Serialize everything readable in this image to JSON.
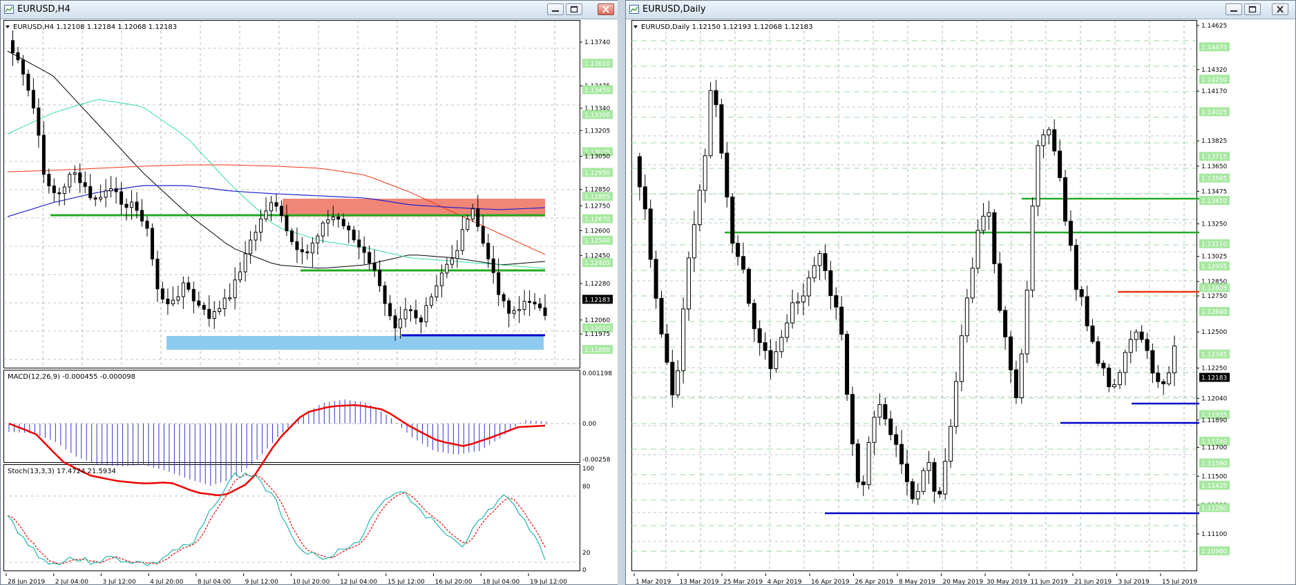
{
  "windows": {
    "left": {
      "title": "EURUSD,H4",
      "info": "EURUSD,H4  1.12108 1.12184 1.12068 1.12183",
      "price_axis": [
        "1.13740",
        "1.13610",
        "1.13475",
        "1.13450",
        "1.13340",
        "1.13300",
        "1.13205",
        "1.13075",
        "1.13050",
        "1.12950",
        "1.12850",
        "1.12805",
        "1.12750",
        "1.12670",
        "1.12600",
        "1.12540",
        "1.12450",
        "1.12405",
        "1.12280",
        "1.12183",
        "1.12060",
        "1.12010",
        "1.11975",
        "1.11880"
      ],
      "time_axis": [
        "28 Jun 2019",
        "2 Jul 04:00",
        "3 Jul 12:00",
        "4 Jul 20:00",
        "8 Jul 04:00",
        "9 Jul 12:00",
        "10 Jul 20:00",
        "12 Jul 04:00",
        "15 Jul 12:00",
        "16 Jul 20:00",
        "18 Jul 04:00",
        "19 Jul 12:00"
      ],
      "macd_label": "MACD(12,26,9) -0.000455 -0.000098",
      "macd_axis": [
        "0.001198",
        "0.00",
        "-0.00258"
      ],
      "stoch_label": "Stoch(13,3,3) 17.4724 21.5934",
      "stoch_axis": [
        "100",
        "80",
        "20",
        "0"
      ]
    },
    "right": {
      "title": "EURUSD,Daily",
      "info": "EURUSD,Daily  1.12150 1.12193 1.12068 1.12183",
      "price_axis": [
        "1.14625",
        "1.14475",
        "1.14320",
        "1.14250",
        "1.14170",
        "1.14025",
        "1.13825",
        "1.13715",
        "1.13650",
        "1.13565",
        "1.13475",
        "1.13410",
        "1.13250",
        "1.13110",
        "1.13025",
        "1.12955",
        "1.12850",
        "1.12805",
        "1.12750",
        "1.12640",
        "1.12500",
        "1.12345",
        "1.12250",
        "1.12183",
        "1.12040",
        "1.11925",
        "1.11890",
        "1.11740",
        "1.11700",
        "1.11590",
        "1.11500",
        "1.11435",
        "1.11300",
        "1.11280",
        "1.11100",
        "1.10980"
      ],
      "time_axis": [
        "1 Mar 2019",
        "13 Mar 2019",
        "25 Mar 2019",
        "4 Apr 2019",
        "16 Apr 2019",
        "26 Apr 2019",
        "8 May 2019",
        "20 May 2019",
        "30 May 2019",
        "11 Jun 2019",
        "21 Jun 2019",
        "3 Jul 2019",
        "15 Jul 2019"
      ]
    }
  },
  "colors": {
    "grid": "#7f8c8d",
    "candle": "#000000",
    "support": "#0000cc",
    "resist_green": "#22aa22",
    "zone_red": "#f08070",
    "zone_blue": "#8ecaf0",
    "macd_hist": "#3333cc",
    "macd_signal": "#ee0000",
    "stoch_main": "#22b6aa",
    "stoch_signal": "#ee0000",
    "axis_label_bg": "#a7e8a0"
  },
  "icons": [
    "chart-window-icon",
    "minimize-icon",
    "maximize-icon",
    "close-icon"
  ]
}
